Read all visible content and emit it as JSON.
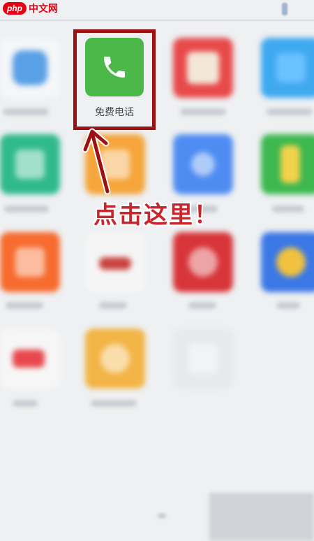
{
  "watermark": {
    "logo_badge": "php",
    "logo_text": "中文网"
  },
  "apps": {
    "highlighted": {
      "label": "免费电话",
      "icon": "phone-icon",
      "color": "#4bb847"
    }
  },
  "annotation": {
    "callout_text": "点击这里！",
    "color": "#9b1114"
  }
}
